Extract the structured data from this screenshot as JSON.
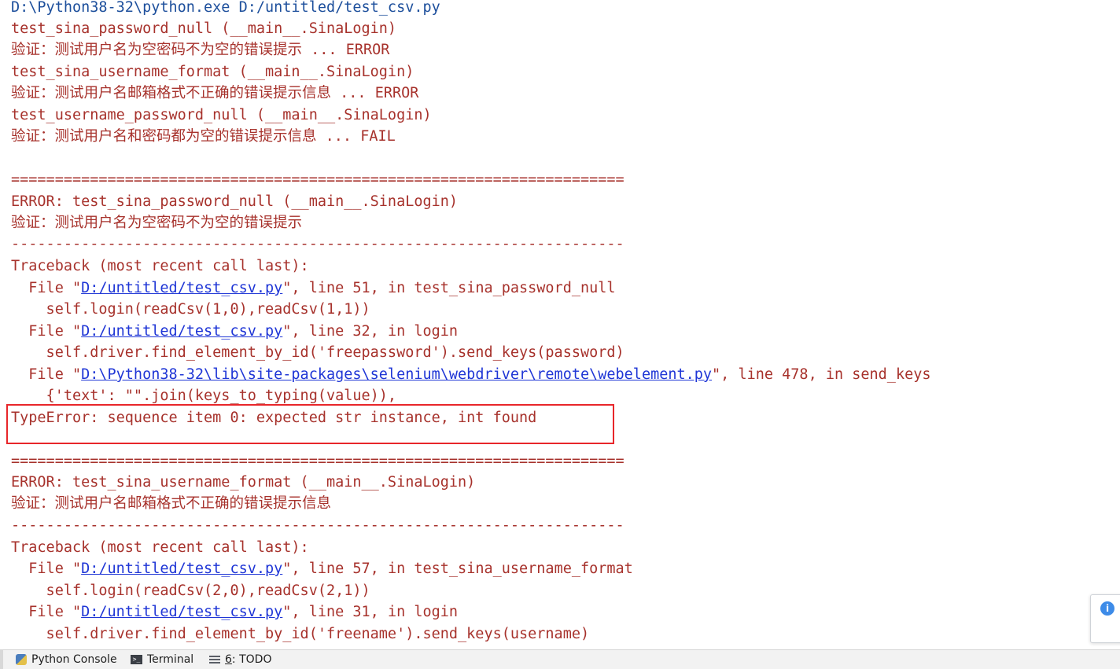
{
  "console": {
    "lines": [
      {
        "text": "D:\\Python38-32\\python.exe D:/untitled/test_csv.py"
      },
      {
        "text": "test_sina_password_null (__main__.SinaLogin)"
      },
      {
        "text": "验证：测试用户名为空密码不为空的错误提示 ... ERROR"
      },
      {
        "text": "test_sina_username_format (__main__.SinaLogin)"
      },
      {
        "text": "验证：测试用户名邮箱格式不正确的错误提示信息 ... ERROR"
      },
      {
        "text": "test_username_password_null (__main__.SinaLogin)"
      },
      {
        "text": "验证：测试用户名和密码都为空的错误提示信息 ... FAIL"
      },
      {
        "text": "======================================================================"
      },
      {
        "text": "ERROR: test_sina_password_null (__main__.SinaLogin)"
      },
      {
        "text": "验证：测试用户名为空密码不为空的错误提示"
      },
      {
        "text": "----------------------------------------------------------------------"
      },
      {
        "text": "Traceback (most recent call last):"
      },
      {
        "prefix": "  File \"",
        "link": "D:/untitled/test_csv.py",
        "suffix": "\", line 51, in test_sina_password_null"
      },
      {
        "text": "    self.login(readCsv(1,0),readCsv(1,1))"
      },
      {
        "prefix": "  File \"",
        "link": "D:/untitled/test_csv.py",
        "suffix": "\", line 32, in login"
      },
      {
        "text": "    self.driver.find_element_by_id('freepassword').send_keys(password)"
      },
      {
        "prefix": "  File \"",
        "link": "D:\\Python38-32\\lib\\site-packages\\selenium\\webdriver\\remote\\webelement.py",
        "suffix": "\", line 478, in send_keys"
      },
      {
        "text": "    {'text': \"\".join(keys_to_typing(value)),"
      },
      {
        "text": "TypeError: sequence item 0: expected str instance, int found"
      },
      {
        "text": "======================================================================"
      },
      {
        "text": "ERROR: test_sina_username_format (__main__.SinaLogin)"
      },
      {
        "text": "验证：测试用户名邮箱格式不正确的错误提示信息"
      },
      {
        "text": "----------------------------------------------------------------------"
      },
      {
        "text": "Traceback (most recent call last):"
      },
      {
        "prefix": "  File \"",
        "link": "D:/untitled/test_csv.py",
        "suffix": "\", line 57, in test_sina_username_format"
      },
      {
        "text": "    self.login(readCsv(2,0),readCsv(2,1))"
      },
      {
        "prefix": "  File \"",
        "link": "D:/untitled/test_csv.py",
        "suffix": "\", line 31, in login"
      },
      {
        "text": "    self.driver.find_element_by_id('freename').send_keys(username)"
      }
    ]
  },
  "toolbar": {
    "python_console": "Python Console",
    "terminal": "Terminal",
    "todo_number": "6",
    "todo_label": ": TODO"
  },
  "info_icon": "i"
}
